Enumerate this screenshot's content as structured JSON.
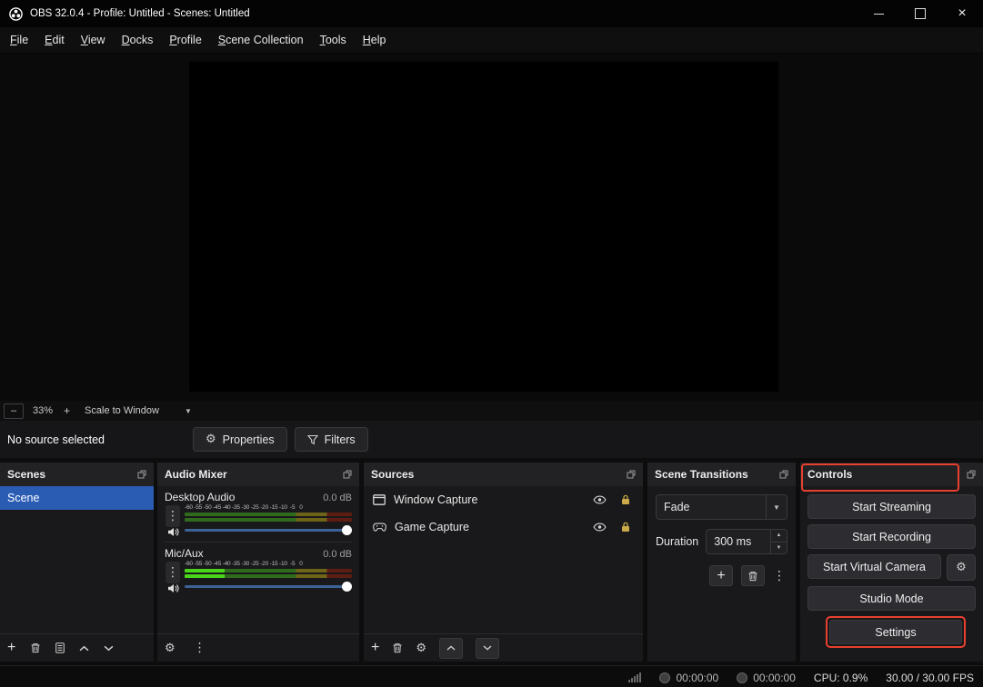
{
  "window": {
    "title": "OBS 32.0.4 - Profile: Untitled - Scenes: Untitled"
  },
  "menu": {
    "items": [
      "File",
      "Edit",
      "View",
      "Docks",
      "Profile",
      "Scene Collection",
      "Tools",
      "Help"
    ]
  },
  "preview": {
    "zoom": "33%",
    "scale_mode": "Scale to Window"
  },
  "source_toolbar": {
    "status": "No source selected",
    "properties": "Properties",
    "filters": "Filters"
  },
  "docks": {
    "scenes": {
      "title": "Scenes",
      "items": [
        {
          "label": "Scene",
          "selected": true
        }
      ]
    },
    "audio_mixer": {
      "title": "Audio Mixer",
      "ticks": "-60 -55 -50 -45 -40 -35 -30 -25 -20 -15 -10  -5   0",
      "channels": [
        {
          "name": "Desktop Audio",
          "db": "0.0 dB",
          "active_pct": 0
        },
        {
          "name": "Mic/Aux",
          "db": "0.0 dB",
          "active_pct": 24
        }
      ]
    },
    "sources": {
      "title": "Sources",
      "items": [
        {
          "label": "Window Capture",
          "icon": "window-capture-icon"
        },
        {
          "label": "Game Capture",
          "icon": "gamepad-icon"
        }
      ]
    },
    "transitions": {
      "title": "Scene Transitions",
      "transition": "Fade",
      "duration_label": "Duration",
      "duration_value": "300 ms"
    },
    "controls": {
      "title": "Controls",
      "buttons": {
        "start_streaming": "Start Streaming",
        "start_recording": "Start Recording",
        "start_virtual_camera": "Start Virtual Camera",
        "studio_mode": "Studio Mode",
        "settings": "Settings"
      }
    }
  },
  "status_bar": {
    "rec_time": "00:00:00",
    "stream_time": "00:00:00",
    "cpu": "CPU: 0.9%",
    "fps": "30.00 / 30.00 FPS"
  },
  "icons": {
    "minus": "–",
    "plus": "+",
    "gear": "⚙",
    "dots_vertical": "⋮",
    "dropdown_arrow": "▼",
    "spin_up": "▲",
    "spin_down": "▼",
    "close": "×"
  },
  "colors": {
    "selection_blue": "#2b5cb4",
    "annotation_red": "#e8402f",
    "meter_green_dim": "#2f6a1d",
    "meter_yellow_dim": "#6e6418",
    "meter_red_dim": "#5e1d12",
    "meter_green_active": "#49d51a"
  }
}
